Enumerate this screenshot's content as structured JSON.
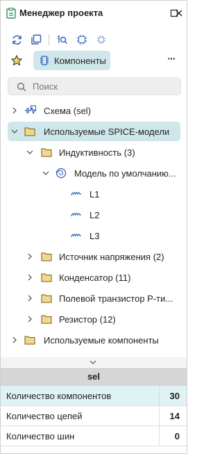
{
  "window": {
    "title": "Менеджер проекта"
  },
  "toolbar2": {
    "tab_label": "Компоненты",
    "more_label": "···"
  },
  "search": {
    "placeholder": "Поиск",
    "value": ""
  },
  "tree": {
    "items": [
      {
        "label": "Схема (sel)"
      },
      {
        "label": "Используемые SPICE-модели"
      },
      {
        "label": "Индуктивность (3)"
      },
      {
        "label": "Модель по умолчанию..."
      },
      {
        "label": "L1"
      },
      {
        "label": "L2"
      },
      {
        "label": "L3"
      },
      {
        "label": "Источник напряжения (2)"
      },
      {
        "label": "Конденсатор (11)"
      },
      {
        "label": "Полевой транзистор P-ти..."
      },
      {
        "label": "Резистор (12)"
      },
      {
        "label": "Используемые компоненты"
      }
    ]
  },
  "properties": {
    "header": "sel",
    "rows": [
      {
        "name": "Количество компонентов",
        "value": "30"
      },
      {
        "name": "Количество цепей",
        "value": "14"
      },
      {
        "name": "Количество шин",
        "value": "0"
      }
    ]
  },
  "colors": {
    "accent": "#cfe6ea",
    "folder": "#e9c46a",
    "icon_blue": "#2f5fb3"
  }
}
